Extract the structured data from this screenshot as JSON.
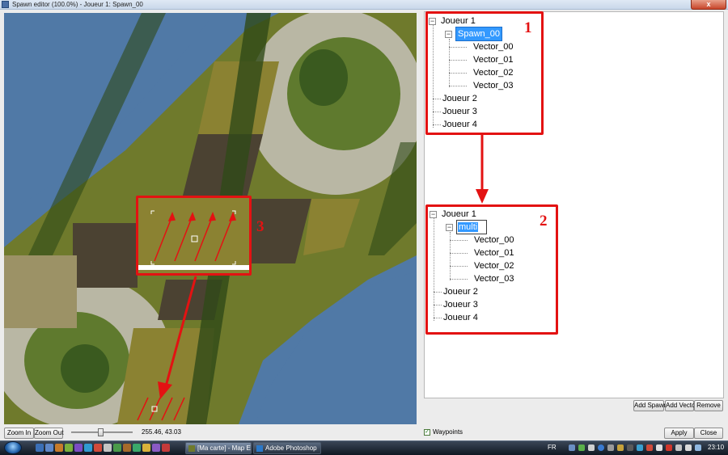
{
  "window": {
    "title": "Spawn editor (100.0%) - Joueur 1: Spawn_00",
    "close_label": "x"
  },
  "map": {
    "callout_number": "3",
    "colors": {
      "water": "#5079a6",
      "grass": "#6f7a2c",
      "field": "#8b8232",
      "rock": "#b9b7a4",
      "forest": "#3a5a1f",
      "dark_field": "#4b4232",
      "highlight": "#e31212"
    }
  },
  "tree_before": {
    "callout_number": "1",
    "root": "Joueur 1",
    "group": "Spawn_00",
    "vectors": [
      "Vector_00",
      "Vector_01",
      "Vector_02",
      "Vector_03"
    ],
    "others": [
      "Joueur 2",
      "Joueur 3",
      "Joueur 4"
    ]
  },
  "tree_after": {
    "callout_number": "2",
    "root": "Joueur 1",
    "group": "multi",
    "vectors": [
      "Vector_00",
      "Vector_01",
      "Vector_02",
      "Vector_03"
    ],
    "others": [
      "Joueur 2",
      "Joueur 3",
      "Joueur 4"
    ]
  },
  "tree_buttons": {
    "add_spawn": "Add Spawn",
    "add_vector": "Add Vector",
    "remove": "Remove"
  },
  "bottom": {
    "zoom_in": "Zoom In",
    "zoom_out": "Zoom Out",
    "coords": "255.46, 43.03",
    "waypoints_label": "Waypoints",
    "waypoints_checked": true,
    "apply": "Apply",
    "close": "Close"
  },
  "taskbar": {
    "tasks": [
      "[Ma carte] - Map Ed...",
      "Adobe Photoshop"
    ],
    "language": "FR",
    "clock": "23:10"
  }
}
